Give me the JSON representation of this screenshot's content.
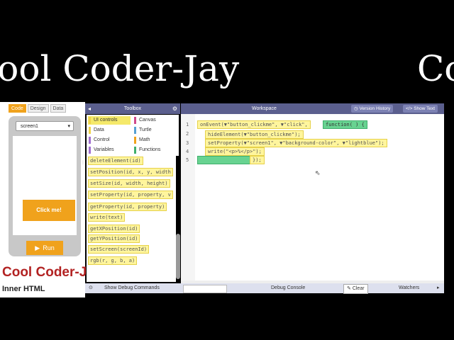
{
  "banner": {
    "left_text": "Cool Coder-Jay",
    "right_text": "Cool Coder-Jay"
  },
  "mode_tabs": [
    "Code",
    "Design",
    "Data"
  ],
  "app_preview": {
    "screen_select": "screen1",
    "click_button": "Click me!",
    "run_button": "Run"
  },
  "caption": {
    "title": "Cool Coder-Jay",
    "subtitle": "Inner HTML"
  },
  "toolbox": {
    "title": "Toolbox",
    "categories": [
      {
        "label": "UI controls",
        "color": "#f0d34a"
      },
      {
        "label": "Canvas",
        "color": "#d04a8a"
      },
      {
        "label": "Data",
        "color": "#f0d34a"
      },
      {
        "label": "Turtle",
        "color": "#56a0d3"
      },
      {
        "label": "Control",
        "color": "#a16fd0"
      },
      {
        "label": "Math",
        "color": "#f0a21c"
      },
      {
        "label": "Variables",
        "color": "#a16fd0"
      },
      {
        "label": "Functions",
        "color": "#3fae6c"
      }
    ],
    "blocks": [
      "deleteElement(id)",
      "setPosition(id, x, y, width",
      "setSize(id, width, height)",
      "setProperty(id, property, v",
      "getProperty(id, property)",
      "write(text)",
      "getXPosition(id)",
      "getYPosition(id)",
      "setScreen(screenId)",
      "rgb(r, g, b, a)"
    ]
  },
  "workspace": {
    "title": "Workspace",
    "version_history": "Version History",
    "show_text": "Show Text",
    "line_numbers": [
      "1",
      "2",
      "3",
      "4",
      "5"
    ],
    "code": {
      "line1_a": "onEvent(▼\"button_clickme\", ▼\"click\",",
      "line1_b": "function( ) {",
      "line2": "hideElement(▼\"button_clickme\");",
      "line3": "setProperty(▼\"screen1\", ▼\"background-color\", ▼\"lightblue\");",
      "line4": "write(\"<p>%</p>\");",
      "line5": "});"
    }
  },
  "debug": {
    "show_commands": "Show Debug Commands",
    "console": "Debug Console",
    "clear": "Clear",
    "watchers": "Watchers"
  }
}
